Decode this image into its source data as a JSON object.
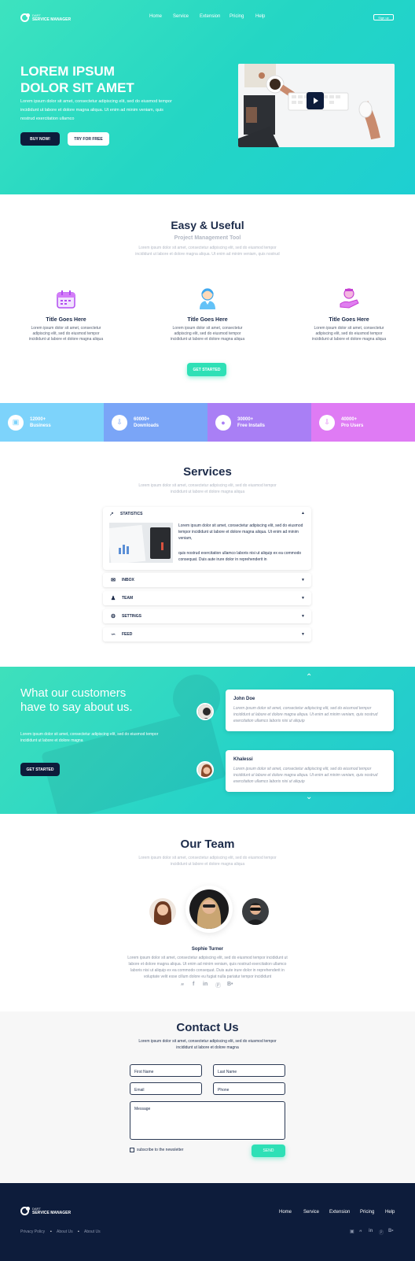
{
  "brand": {
    "line1": "DART",
    "line2": "SERVICE MANAGER"
  },
  "nav": {
    "items": [
      "Home",
      "Service",
      "Extension",
      "Pricing",
      "Help"
    ],
    "signup": "Sign up"
  },
  "hero": {
    "title_line1": "LOREM IPSUM",
    "title_line2": "DOLOR SIT AMET",
    "text": "Lorem ipsum dolor sit amet, consectetur adipiscing elit, sed do eiusmod tempor incididunt ut labore et dolore magna aliqua. Ut enim ad minim veniam, quis nostrud exercitation ullamco",
    "buy_label": "BUY NOW!",
    "try_label": "TRY FOR FREE"
  },
  "features": {
    "title": "Easy & Useful",
    "subtitle": "Project Management Tool",
    "intro": "Lorem ipsum dolor sit amet, consectetur adipiscing elit, sed do eiusmod tempor incididunt ut labore et dolore magna aliqua. Ut enim ad minim veniam, quis nostrud",
    "cards": [
      {
        "title": "Title Goes Here",
        "text": "Lorem ipsum dolor sit amet, consectetur adipiscing elit, sed do eiusmod tempor incididunt ut labore et dolore magna aliqua",
        "icon": "calendar-icon"
      },
      {
        "title": "Title Goes Here",
        "text": "Lorem ipsum dolor sit amet, consectetur adipiscing elit, sed do eiusmod tempor incididunt ut labore et dolore magna aliqua",
        "icon": "support-agent-icon"
      },
      {
        "title": "Title Goes Here",
        "text": "Lorem ipsum dolor sit amet, consectetur adipiscing elit, sed do eiusmod tempor incididunt ut labore et dolore magna aliqua",
        "icon": "user-hand-icon"
      }
    ],
    "cta": "GET STARTED"
  },
  "stats": [
    {
      "num": "12000+",
      "label": "Business",
      "color": "#7dd3fb",
      "icon": "folder-icon"
    },
    {
      "num": "60000+",
      "label": "Downloads",
      "color": "#7aa5f7",
      "icon": "download-icon"
    },
    {
      "num": "30000+",
      "label": "Free Installs",
      "color": "#a97ff5",
      "icon": "user-icon"
    },
    {
      "num": "40000+",
      "label": "Pro Users",
      "color": "#df7bf4",
      "icon": "download-icon"
    }
  ],
  "services": {
    "title": "Services",
    "intro": "Lorem ipsum dolor sit amet, consectetur adipiscing elit, sed do eiusmod tempor incididunt ut labore et dolore magna aliqua",
    "open": {
      "label": "STATISTICS",
      "p1": "Lorem ipsum dolor sit amet, consectetur adipiscing elit, sed do eiusmod tempor incididunt ut labore et dolore magna aliqua. Ut enim ad minim veniam,",
      "p2": "quis nostrud exercitation ullamco laboris nisi ut aliquip ex ea commodo consequat. Duis aute irure dolor in reprehenderit in"
    },
    "rows": [
      {
        "label": "INBOX",
        "icon": "inbox-icon"
      },
      {
        "label": "TEAM",
        "icon": "team-icon"
      },
      {
        "label": "SETTINGS",
        "icon": "gear-icon"
      },
      {
        "label": "FEED",
        "icon": "rss-icon"
      }
    ]
  },
  "testimonials": {
    "title_line1": "What our customers",
    "title_line2": "have to say about us.",
    "text": "Lorem ipsum dolor sit amet, consectetur adipiscing elit, sed do eiusmod tempor incididunt ut labore et dolore magna",
    "cta": "GET STARTED",
    "items": [
      {
        "name": "John Doe",
        "text": "Lorem ipsum dolor sit amet, consectetur adipiscing elit, sed do eiusmod tempor incididunt ut labore et dolore magna aliqua. Ut enim ad minim veniam, quis nostrud exercitation ullamco laboris nisi ut aliquip"
      },
      {
        "name": "Khalessi",
        "text": "Lorem ipsum dolor sit amet, consectetur adipiscing elit, sed do eiusmod tempor incididunt ut labore et dolore magna aliqua. Ut enim ad minim veniam, quis nostrud exercitation ullamco laboris nisi ut aliquip"
      }
    ]
  },
  "team": {
    "title": "Our Team",
    "intro": "Lorem ipsum dolor sit amet, consectetur adipiscing elit, sed do eiusmod tempor incididunt ut labore et dolore magna aliqua",
    "member_name": "Sophie Turner",
    "member_text": "Lorem ipsum dolor sit amet, consectetur adipiscing elit, sed do eiusmod tempor incididunt ut labore et dolore magna aliqua. Ut enim ad minim veniam, quis nostrud exercitation ullamco laboris nisi ut aliquip ex ea commodo consequat. Duis aute irure dolor in reprehenderit in voluptate velit esse cillum dolore eu fugiat nulla pariatur tempor incididunt",
    "social": [
      "twitter-icon",
      "facebook-icon",
      "linkedin-icon",
      "pinterest-icon",
      "behance-icon"
    ]
  },
  "contact": {
    "title": "Contact Us",
    "intro": "Lorem ipsum dolor sit amet, consectetur adipiscing elit, sed do eiusmod tempor incididunt ut labore et dolore magna",
    "first_name": "First Name",
    "last_name": "Last Name",
    "email": "Email",
    "phone": "Phone",
    "message": "Message",
    "newsletter": "subscribe to the newsletter",
    "send": "SEND"
  },
  "footer": {
    "nav": [
      "Home",
      "Service",
      "Extension",
      "Pricing",
      "Help"
    ],
    "links": [
      "Privacy Policy",
      "About Us",
      "About Us"
    ],
    "social": [
      "facebook-icon",
      "twitter-icon",
      "linkedin-icon",
      "pinterest-icon",
      "behance-icon"
    ]
  }
}
